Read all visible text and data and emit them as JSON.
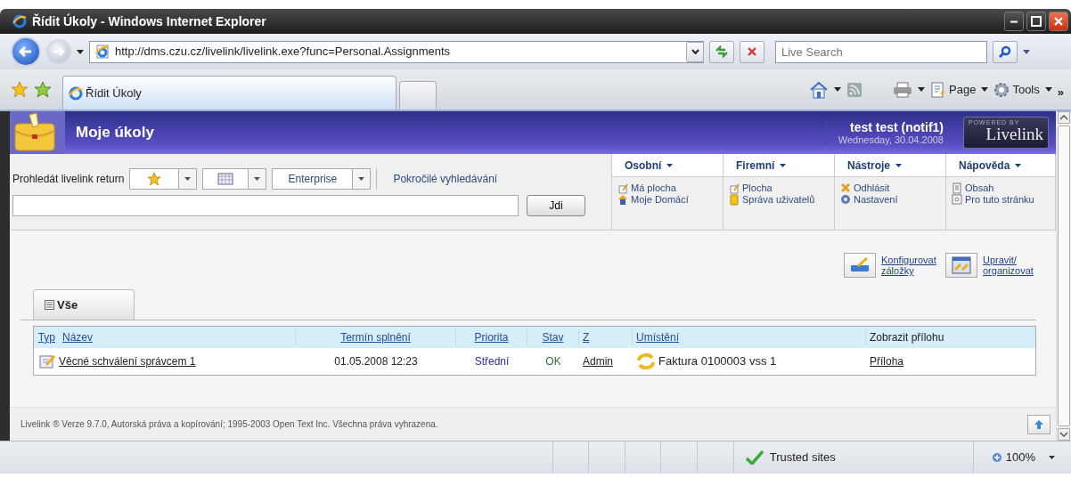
{
  "window": {
    "title": "Řídit Úkoly - Windows Internet Explorer"
  },
  "address_bar": {
    "url": "http://dms.czu.cz/livelink/livelink.exe?func=Personal.Assignments"
  },
  "search_box": {
    "placeholder": "Live Search"
  },
  "browser_tabs": [
    {
      "label": "Řídit Úkoly",
      "selected": true
    }
  ],
  "command_bar": {
    "buttons": [
      "Page",
      "Tools"
    ],
    "overflow": "»"
  },
  "header": {
    "title": "Moje úkoly",
    "user": "test test (notif1)",
    "date": "Wednesday, 30.04.2008",
    "logo_small": "POWERED BY",
    "logo": "Livelink"
  },
  "search": {
    "label": "Prohledát livelink return",
    "scope": "Enterprise",
    "advanced": "Pokročilé vyhledávání",
    "button": "Jdi"
  },
  "menus": [
    {
      "title": "Osobní",
      "items": [
        "Má plocha",
        "Moje Domácí"
      ]
    },
    {
      "title": "Firemní",
      "items": [
        "Plocha",
        "Správa uživatelů"
      ]
    },
    {
      "title": "Nástroje",
      "items": [
        "Odhlásit",
        "Nastavení"
      ]
    },
    {
      "title": "Nápověda",
      "items": [
        "Obsah",
        "Pro tuto stránku"
      ]
    }
  ],
  "actions": [
    "Konfigurovat záložky",
    "Upravit/ organizovat"
  ],
  "content_tabs": [
    {
      "label": "Vše",
      "selected": true
    }
  ],
  "table": {
    "columns": [
      {
        "label": "Typ",
        "link": true
      },
      {
        "label": "Název",
        "link": true
      },
      {
        "label": "Termín splnění",
        "link": true
      },
      {
        "label": "Priorita",
        "link": true
      },
      {
        "label": "Stav",
        "link": true
      },
      {
        "label": "Z",
        "link": true
      },
      {
        "label": "Umístění",
        "link": true
      },
      {
        "label": "Zobrazit přílohu",
        "link": false
      }
    ],
    "rows": [
      {
        "name": "Věcné schválení správcem 1",
        "due": "01.05.2008 12:23",
        "priority": "Střední",
        "status": "OK",
        "from": "Admin",
        "location": "Faktura 0100003 vss 1",
        "attachment": "Příloha"
      }
    ]
  },
  "footer": "Livelink ® Verze 9.7.0, Autorská práva a kopírování; 1995-2003 Open Text Inc. Všechna práva vyhrazena.",
  "status_bar": {
    "zone": "Trusted sites",
    "zoom": "100%"
  }
}
